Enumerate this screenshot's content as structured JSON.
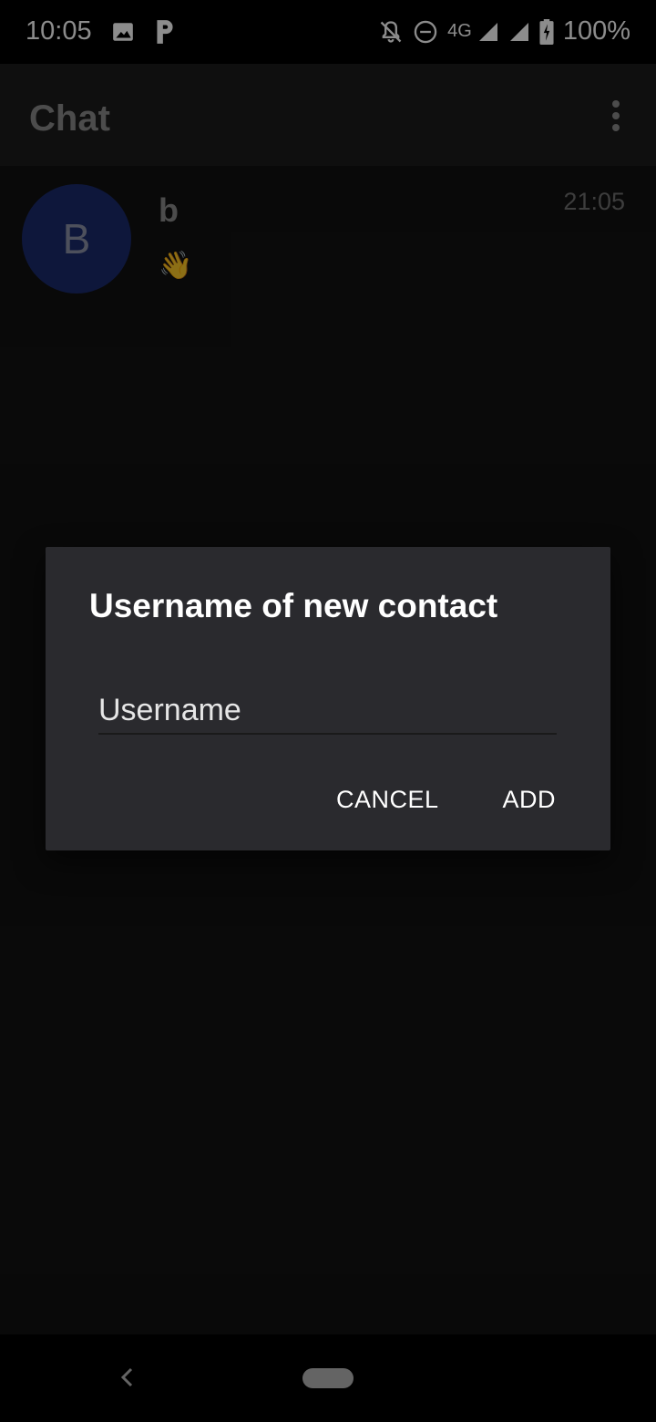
{
  "status_bar": {
    "time": "10:05",
    "network_type": "4G",
    "battery_percent": "100%",
    "icons": [
      "image-icon",
      "parking-icon",
      "notifications-off-icon",
      "do-not-disturb-icon",
      "signal-icon",
      "signal-icon",
      "battery-charging-icon"
    ]
  },
  "app_bar": {
    "title": "Chat",
    "menu_icon": "more-vert-icon"
  },
  "chats": [
    {
      "avatar_letter": "B",
      "avatar_color": "#1a2a6c",
      "name": "b",
      "preview": "👋",
      "time": "21:05"
    }
  ],
  "dialog": {
    "title": "Username of new contact",
    "input_placeholder": "Username",
    "input_value": "",
    "cancel_label": "CANCEL",
    "add_label": "ADD"
  },
  "nav_bar": {
    "back_icon": "back-chevron-icon",
    "home_icon": "home-pill-icon"
  }
}
